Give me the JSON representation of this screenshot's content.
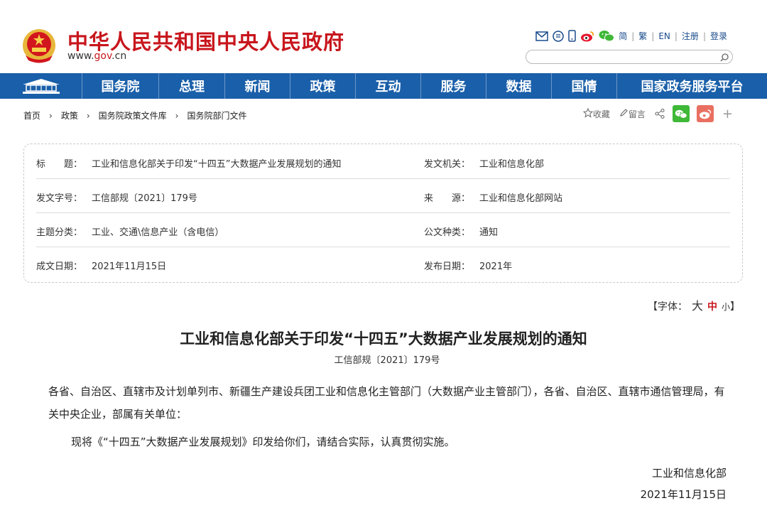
{
  "site": {
    "title": "中华人民共和国中央人民政府",
    "url_prefix": "www.",
    "url_mid": "gov",
    "url_suffix": ".cn"
  },
  "top_links": [
    "简",
    "繁",
    "EN",
    "注册",
    "登录"
  ],
  "search": {
    "placeholder": ""
  },
  "nav": [
    "国务院",
    "总理",
    "新闻",
    "政策",
    "互动",
    "服务",
    "数据",
    "国情",
    "国家政务服务平台"
  ],
  "breadcrumb": [
    "首页",
    "政策",
    "国务院政策文件库",
    "国务院部门文件"
  ],
  "tools": {
    "favorite": "收藏",
    "comment": "留言",
    "plus": "+"
  },
  "info": {
    "rows": [
      {
        "label": "标　　题：",
        "value": "工业和信息化部关于印发“十四五”大数据产业发展规划的通知",
        "label2": "发文机关：",
        "value2": "工业和信息化部"
      },
      {
        "label": "发文字号：",
        "value": "工信部规〔2021〕179号",
        "label2": "来　　源：",
        "value2": "工业和信息化部网站"
      },
      {
        "label": "主题分类：",
        "value": "工业、交通\\信息产业（含电信）",
        "label2": "公文种类：",
        "value2": "通知"
      },
      {
        "label": "成文日期：",
        "value": "2021年11月15日",
        "label2": "发布日期：",
        "value2": "2021年"
      }
    ]
  },
  "font_size": {
    "prefix": "【字体：",
    "big": "大",
    "mid": "中",
    "small": "小",
    "suffix": "】"
  },
  "article": {
    "title": "工业和信息化部关于印发“十四五”大数据产业发展规划的通知",
    "number": "工信部规〔2021〕179号",
    "para1": "各省、自治区、直辖市及计划单列市、新疆生产建设兵团工业和信息化主管部门（大数据产业主管部门），各省、自治区、直辖市通信管理局，有关中央企业，部属有关单位：",
    "para2": "现将《“十四五”大数据产业发展规划》印发给你们，请结合实际，认真贯彻实施。",
    "signer": "工业和信息化部",
    "date": "2021年11月15日"
  },
  "colors": {
    "brand_red": "#c8161d",
    "nav_blue": "#1a5fa9",
    "wechat_green": "#3fb838",
    "weibo_red": "#e6162d"
  }
}
